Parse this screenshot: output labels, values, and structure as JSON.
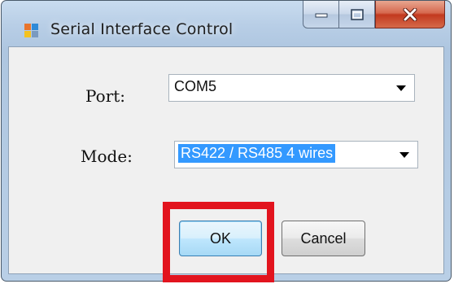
{
  "window": {
    "title": "Serial Interface Control",
    "icon": "windows-app-icon",
    "caption_buttons": [
      "minimize-icon",
      "maximize-icon",
      "close-icon"
    ]
  },
  "form": {
    "port_label": "Port:",
    "port_value": "COM5",
    "mode_label": "Mode:",
    "mode_value": "RS422 / RS485 4 wires"
  },
  "buttons": {
    "ok_label": "OK",
    "cancel_label": "Cancel"
  },
  "annotation": {
    "highlight_color": "#e2141e",
    "highlight_target": "ok-button"
  }
}
